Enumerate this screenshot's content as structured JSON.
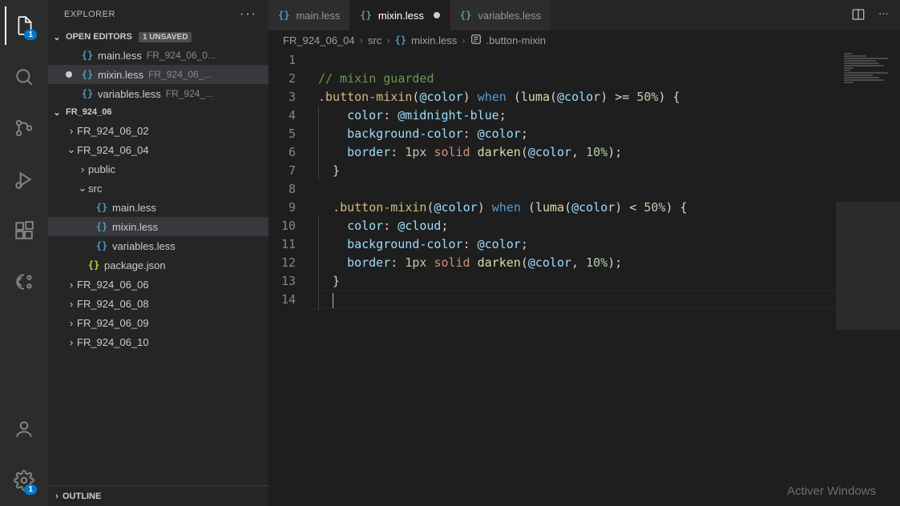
{
  "activityBadge": {
    "explorer": "1",
    "settings": "1"
  },
  "sidebar": {
    "title": "EXPLORER",
    "openEditors": {
      "label": "OPEN EDITORS",
      "unsaved": "1 UNSAVED",
      "items": [
        {
          "name": "main.less",
          "desc": "FR_924_06_0...",
          "modified": false
        },
        {
          "name": "mixin.less",
          "desc": "FR_924_06_...",
          "modified": true
        },
        {
          "name": "variables.less",
          "desc": "FR_924_...",
          "modified": false
        }
      ]
    },
    "workspace": {
      "name": "FR_924_06",
      "folders": [
        {
          "name": "FR_924_06_02",
          "expanded": false,
          "depth": 1
        },
        {
          "name": "FR_924_06_04",
          "expanded": true,
          "depth": 1,
          "children": [
            {
              "name": "public",
              "expanded": false,
              "depth": 2
            },
            {
              "name": "src",
              "expanded": true,
              "depth": 2,
              "children": [
                {
                  "name": "main.less",
                  "type": "less"
                },
                {
                  "name": "mixin.less",
                  "type": "less",
                  "selected": true
                },
                {
                  "name": "variables.less",
                  "type": "less"
                }
              ]
            },
            {
              "name": "package.json",
              "type": "json",
              "depth": 2
            }
          ]
        },
        {
          "name": "FR_924_06_06",
          "expanded": false,
          "depth": 1
        },
        {
          "name": "FR_924_06_08",
          "expanded": false,
          "depth": 1
        },
        {
          "name": "FR_924_06_09",
          "expanded": false,
          "depth": 1
        },
        {
          "name": "FR_924_06_10",
          "expanded": false,
          "depth": 1
        }
      ]
    },
    "outline": "OUTLINE"
  },
  "tabs": [
    {
      "name": "main.less",
      "active": false,
      "dirty": false
    },
    {
      "name": "mixin.less",
      "active": true,
      "dirty": true
    },
    {
      "name": "variables.less",
      "active": false,
      "dirty": false
    }
  ],
  "breadcrumb": {
    "parts": [
      "FR_924_06_04",
      "src",
      "mixin.less",
      ".button-mixin"
    ]
  },
  "code": {
    "lineCount": 14,
    "lines": {
      "l2": "// mixin guarded",
      "l3_sel": ".button-mixin",
      "l3_var": "@color",
      "l3_when": "when",
      "l3_luma": "luma",
      "l3_op": ">=",
      "l3_num": "50%",
      "l4_prop": "color",
      "l4_val": "@midnight-blue",
      "l5_prop": "background-color",
      "l5_val": "@color",
      "l6_prop": "border",
      "l6_px": "1px",
      "l6_solid": "solid",
      "l6_darken": "darken",
      "l6_pct": "10%",
      "l9_op": "<",
      "l10_val": "@cloud"
    }
  },
  "watermark": "Activer Windows"
}
